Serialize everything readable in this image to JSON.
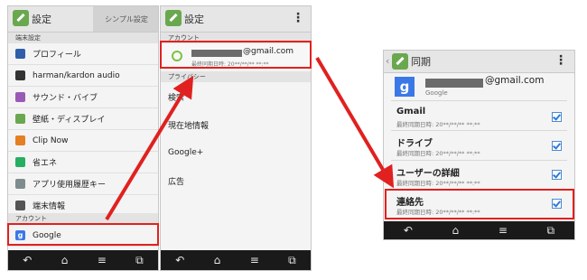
{
  "screen1": {
    "title": "設定",
    "simple_tab": "シンプル設定",
    "section_device": "端末設定",
    "items": [
      {
        "label": "プロフィール",
        "icon": "profile-icon",
        "color": "#2f5fa8"
      },
      {
        "label": "harman/kardon audio",
        "icon": "audio-icon",
        "color": "#333333"
      },
      {
        "label": "サウンド・バイブ",
        "icon": "sound-icon",
        "color": "#9b59b6"
      },
      {
        "label": "壁紙・ディスプレイ",
        "icon": "wallpaper-icon",
        "color": "#6aa84f"
      },
      {
        "label": "Clip Now",
        "icon": "clip-icon",
        "color": "#e67e22"
      },
      {
        "label": "省エネ",
        "icon": "battery-icon",
        "color": "#27ae60"
      },
      {
        "label": "アプリ使用履歴キー",
        "icon": "history-icon",
        "color": "#7f8c8d"
      },
      {
        "label": "端末情報",
        "icon": "info-icon",
        "color": "#555555"
      }
    ],
    "section_account": "アカウント",
    "google_label": "Google"
  },
  "screen2": {
    "title": "設定",
    "section_account": "アカウント",
    "email_suffix": "@gmail.com",
    "sync_time": "最終同期日時: 20**/**/** **:**",
    "section_privacy": "プライバシー",
    "items": [
      "検索",
      "現在地情報",
      "Google+",
      "広告"
    ]
  },
  "screen3": {
    "title": "同期",
    "email_suffix": "@gmail.com",
    "provider": "Google",
    "items": [
      {
        "name": "Gmail",
        "sub": "最終同期日時: 20**/**/** **:**"
      },
      {
        "name": "ドライブ",
        "sub": "最終同期日時: 20**/**/** **:**"
      },
      {
        "name": "ユーザーの詳細",
        "sub": "最終同期日時: 20**/**/** **:**"
      },
      {
        "name": "連絡先",
        "sub": "最終同期日時: 20**/**/** **:**"
      }
    ]
  },
  "navbar_icons": [
    "back-icon",
    "home-icon",
    "menu-icon",
    "recent-apps-icon"
  ],
  "accent_red": "#e0211f",
  "google_blue": "#3b78e7",
  "check_blue": "#2f7ad6"
}
